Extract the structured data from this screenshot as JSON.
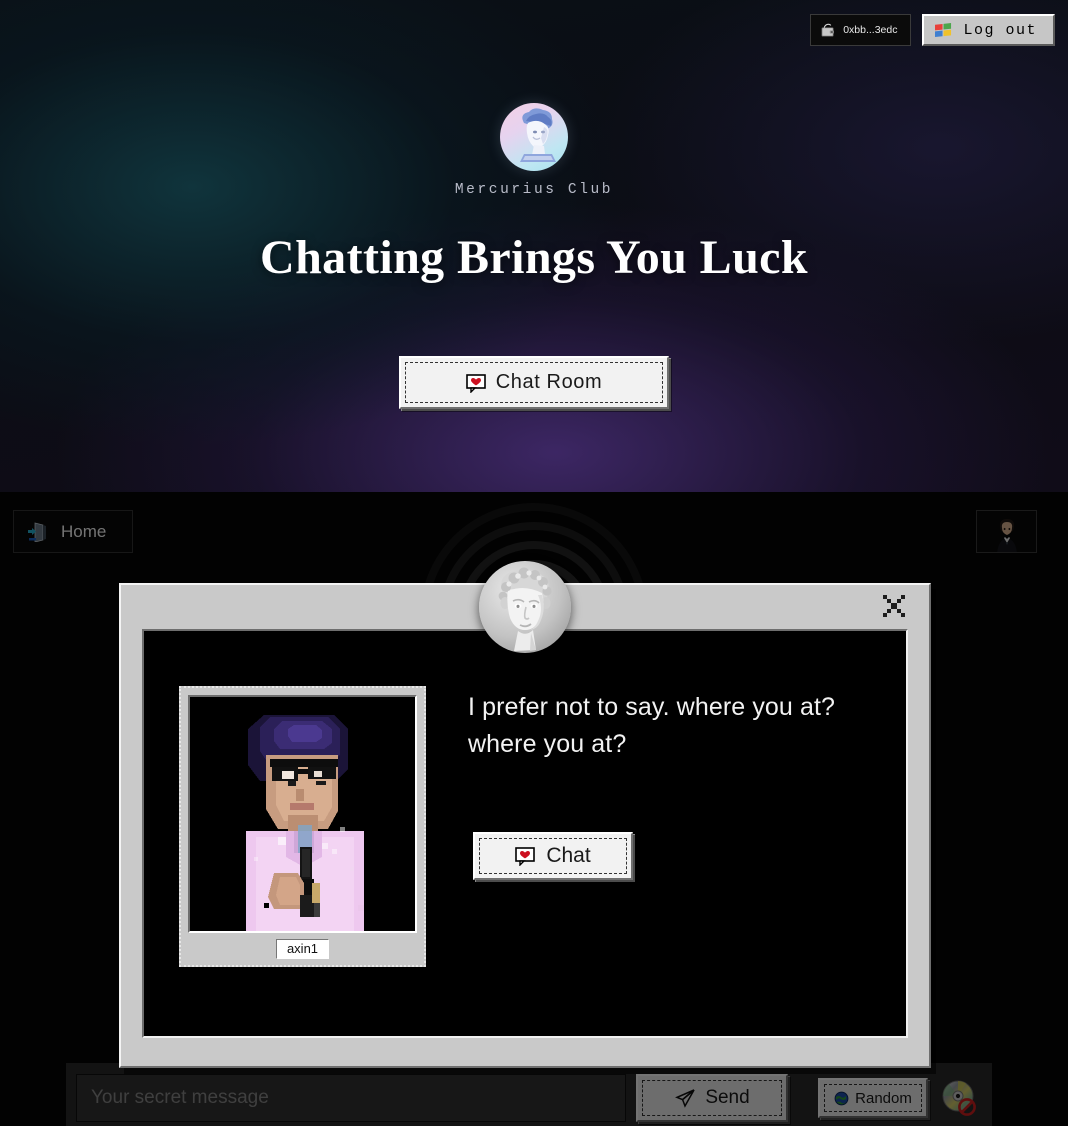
{
  "topbar": {
    "wallet_label": "0xbb...3edc",
    "wallet_icon": "wallet-icon",
    "logout_label": "Log out",
    "logout_icon": "windows-flag-icon"
  },
  "hero": {
    "logo_icon": "classical-bust-logo-icon",
    "club_name": "Mercurius Club",
    "title": "Chatting Brings You Luck",
    "chatroom_button": {
      "label": "Chat Room",
      "icon": "heart-speech-bubble-icon"
    }
  },
  "room": {
    "home_button": {
      "label": "Home",
      "icon": "door-exit-icon"
    },
    "self_avatar_icon": "user-portrait-avatar",
    "compose": {
      "input_value": "",
      "input_placeholder": "Your secret message",
      "send_label": "Send",
      "send_icon": "paper-plane-icon",
      "random_label": "Random",
      "random_icon": "globe-icon",
      "cd_icon": "cd-disabled-icon"
    }
  },
  "modal": {
    "close_icon": "pixel-close-x-icon",
    "avatar_icon": "classical-bust-avatar-icon",
    "profile": {
      "photo_icon": "pixelated-person-with-microphone-photo",
      "username": "axin1",
      "bio": "I prefer not to say. where you at? where you at?",
      "chat_button": {
        "label": "Chat",
        "icon": "heart-speech-bubble-icon"
      }
    }
  },
  "colors": {
    "win95_face": "#c9c9c9",
    "button_face": "#f2f2f2",
    "hero_teal": "#10363e",
    "hero_purple": "#3f2868",
    "accent_heart": "#cc1020",
    "text_light": "#f2f2f2"
  }
}
